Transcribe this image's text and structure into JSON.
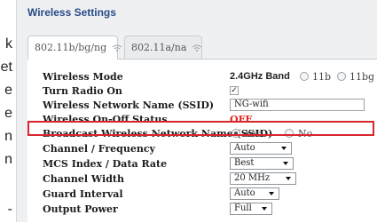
{
  "edge_text": [
    "k",
    "et",
    "e",
    "e",
    "n",
    "n",
    "-"
  ],
  "panel": {
    "title": "Wireless Settings"
  },
  "tabs": [
    {
      "label": "802.11b/bg/ng",
      "active": true
    },
    {
      "label": "802.11a/na",
      "active": false
    }
  ],
  "settings": {
    "wireless_mode": {
      "label": "Wireless Mode",
      "band_text": "2.4GHz Band",
      "options": [
        "11b",
        "11bg"
      ]
    },
    "turn_radio_on": {
      "label": "Turn Radio On",
      "checked": true,
      "check_glyph": "✓"
    },
    "ssid": {
      "label": "Wireless Network Name (SSID)",
      "value": "NG-wifi"
    },
    "on_off_status": {
      "label": "Wireless On-Off Status",
      "value": "OFF"
    },
    "broadcast_ssid": {
      "label": "Broadcast Wireless Network Name (SSID)",
      "yes": "Yes",
      "no": "No",
      "selected": "Yes"
    },
    "channel": {
      "label": "Channel / Frequency",
      "value": "Auto"
    },
    "mcs": {
      "label": "MCS Index / Data Rate",
      "value": "Best"
    },
    "channel_width": {
      "label": "Channel Width",
      "value": "20 MHz"
    },
    "guard_interval": {
      "label": "Guard Interval",
      "value": "Auto"
    },
    "output_power": {
      "label": "Output Power",
      "value": "Full"
    }
  },
  "colors": {
    "title": "#2a4a86",
    "status_off": "#e0281d",
    "highlight_border": "#d8262d"
  }
}
